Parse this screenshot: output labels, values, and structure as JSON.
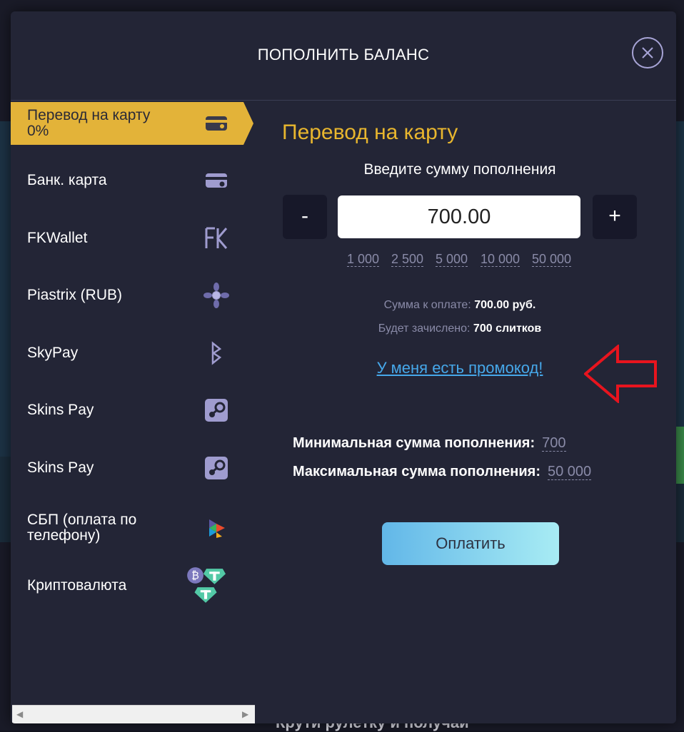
{
  "background": {
    "bottom_text": "Крути рулетку и получай"
  },
  "modal": {
    "title": "ПОПОЛНИТЬ БАЛАНС"
  },
  "sidebar": {
    "items": [
      {
        "label": "Перевод на карту 0%",
        "icon": "card-icon",
        "active": true
      },
      {
        "label": "Банк. карта",
        "icon": "bank-card-icon"
      },
      {
        "label": "FKWallet",
        "icon": "fk-logo-icon"
      },
      {
        "label": "Piastrix (RUB)",
        "icon": "piastrix-icon"
      },
      {
        "label": "SkyPay",
        "icon": "skypay-icon"
      },
      {
        "label": "Skins Pay",
        "icon": "steam-icon"
      },
      {
        "label": "Skins Pay",
        "icon": "steam-icon"
      },
      {
        "label": "СБП (оплата по телефону)",
        "icon": "sbp-icon"
      },
      {
        "label": "Криптовалюта",
        "icon": "crypto-icon"
      }
    ]
  },
  "main": {
    "title": "Перевод на карту",
    "prompt": "Введите сумму пополнения",
    "minus_label": "-",
    "plus_label": "+",
    "amount_value": "700.00",
    "presets": [
      "1 000",
      "2 500",
      "5 000",
      "10 000",
      "50 000"
    ],
    "to_pay_label": "Сумма к оплате:",
    "to_pay_value": "700.00 руб.",
    "credited_label": "Будет зачислено:",
    "credited_value": "700 слитков",
    "promo_link": "У меня есть промокод!",
    "min_label": "Минимальная сумма пополнения:",
    "min_value": "700",
    "max_label": "Максимальная сумма пополнения:",
    "max_value": "50 000",
    "pay_button": "Оплатить"
  },
  "colors": {
    "accent": "#e3b339",
    "modal_bg": "#232536",
    "link": "#46a8ea",
    "annotation": "#e8141e"
  }
}
